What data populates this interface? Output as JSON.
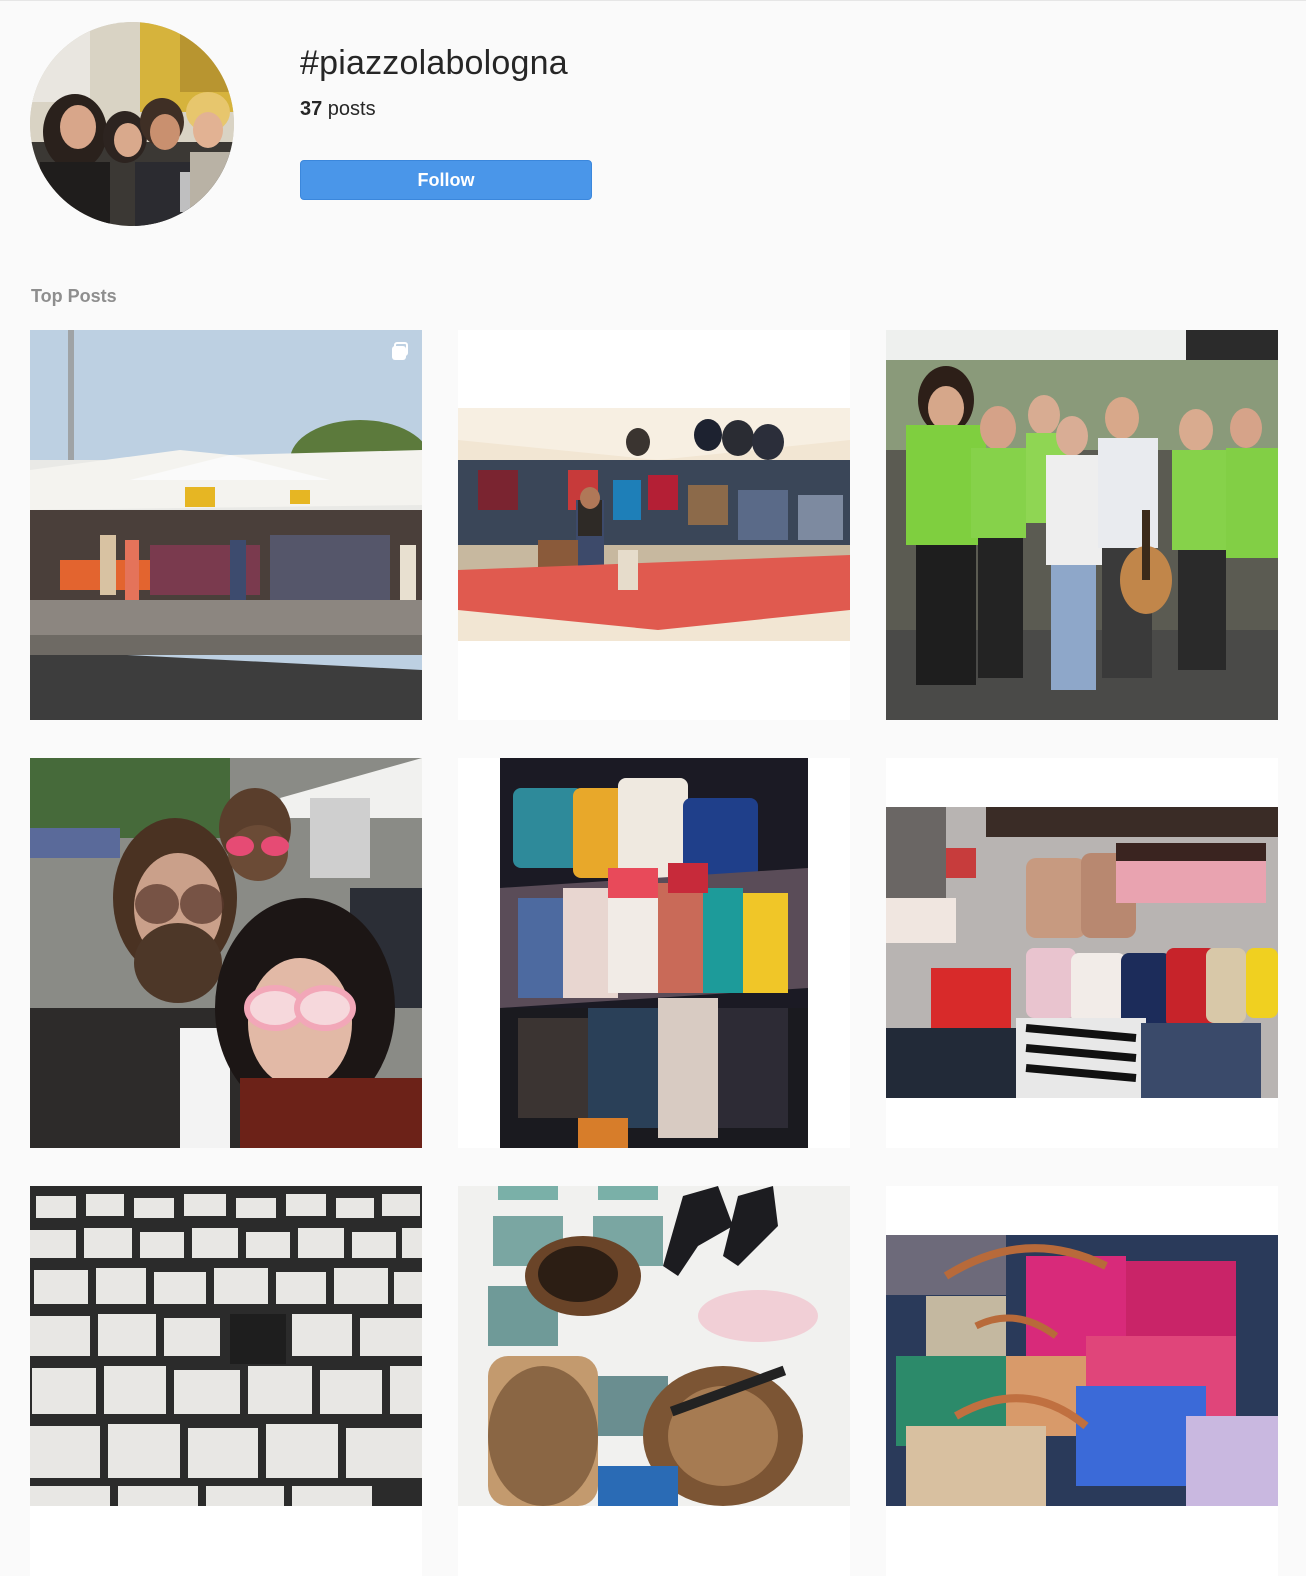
{
  "header": {
    "hashtag": "#piazzolabologna",
    "post_count": "37",
    "post_count_suffix": " posts",
    "follow_label": "Follow"
  },
  "top_posts": {
    "title": "Top Posts"
  },
  "icons": {
    "multi_post": "carousel-icon"
  },
  "colors": {
    "accent": "#4a96e9",
    "background": "#fafafa",
    "muted_text": "#8e8e8e",
    "text": "#262626"
  }
}
